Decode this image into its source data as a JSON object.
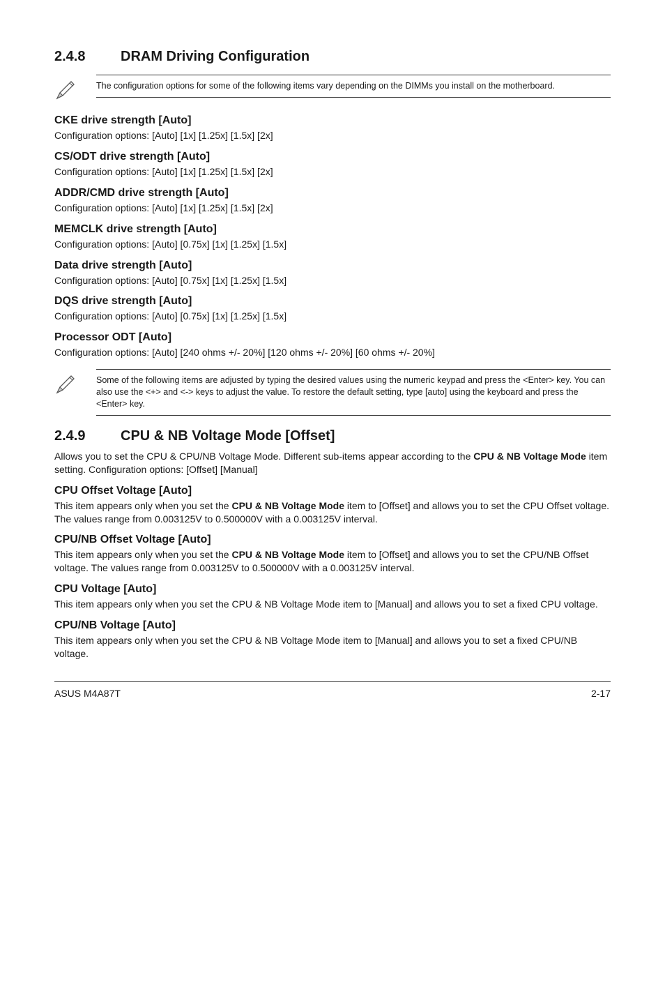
{
  "section_248": {
    "number": "2.4.8",
    "title": "DRAM Driving Configuration",
    "note": "The configuration options for some of the following items vary depending on the DIMMs you install on the motherboard.",
    "sub": {
      "cke": {
        "h": "CKE drive strength [Auto]",
        "b": "Configuration options: [Auto] [1x] [1.25x] [1.5x] [2x]"
      },
      "csodt": {
        "h": "CS/ODT drive strength [Auto]",
        "b": "Configuration options: [Auto] [1x] [1.25x] [1.5x] [2x]"
      },
      "addr": {
        "h": "ADDR/CMD drive strength [Auto]",
        "b": "Configuration options: [Auto] [1x] [1.25x] [1.5x] [2x]"
      },
      "memclk": {
        "h": "MEMCLK drive strength [Auto]",
        "b": "Configuration options: [Auto] [0.75x] [1x] [1.25x] [1.5x]"
      },
      "data": {
        "h": "Data drive strength [Auto]",
        "b": "Configuration options: [Auto] [0.75x] [1x] [1.25x] [1.5x]"
      },
      "dqs": {
        "h": "DQS drive strength [Auto]",
        "b": "Configuration options: [Auto] [0.75x] [1x] [1.25x] [1.5x]"
      },
      "podt": {
        "h": "Processor ODT [Auto]",
        "b": "Configuration options: [Auto] [240 ohms +/- 20%] [120 ohms +/- 20%] [60 ohms +/- 20%]"
      }
    },
    "note2": "Some of the following items are adjusted by typing the desired values using the numeric keypad and press the <Enter> key. You can also use the <+> and <-> keys to adjust the value. To restore the default setting, type [auto] using the keyboard and press the <Enter> key."
  },
  "section_249": {
    "number": "2.4.9",
    "title": "CPU & NB Voltage Mode [Offset]",
    "intro_pre": "Allows you to set the CPU & CPU/NB Voltage Mode. Different sub-items appear according to the ",
    "intro_bold": "CPU & NB Voltage Mode",
    "intro_post": " item setting. Configuration options: [Offset] [Manual]",
    "sub": {
      "cpuoff": {
        "h": "CPU Offset Voltage [Auto]",
        "b_pre": "This item appears only when you set the ",
        "b_bold": "CPU & NB Voltage Mode",
        "b_post": " item to [Offset] and allows you to set the CPU Offset voltage. The values range from 0.003125V to 0.500000V with a 0.003125V interval."
      },
      "cpunboff": {
        "h": "CPU/NB Offset Voltage [Auto]",
        "b_pre": "This item appears only when you set the ",
        "b_bold": "CPU & NB Voltage Mode",
        "b_post": " item to [Offset] and allows you to set the CPU/NB Offset voltage. The values range from 0.003125V to 0.500000V with a 0.003125V interval."
      },
      "cpuv": {
        "h": "CPU Voltage [Auto]",
        "b": "This item appears only when you set the CPU & NB Voltage Mode item to [Manual] and allows you to set a fixed CPU voltage."
      },
      "cpunbv": {
        "h": "CPU/NB Voltage [Auto]",
        "b": "This item appears only when you set the CPU & NB Voltage Mode item to [Manual] and allows you to set a fixed CPU/NB voltage."
      }
    }
  },
  "footer": {
    "left": "ASUS M4A87T",
    "right": "2-17"
  }
}
